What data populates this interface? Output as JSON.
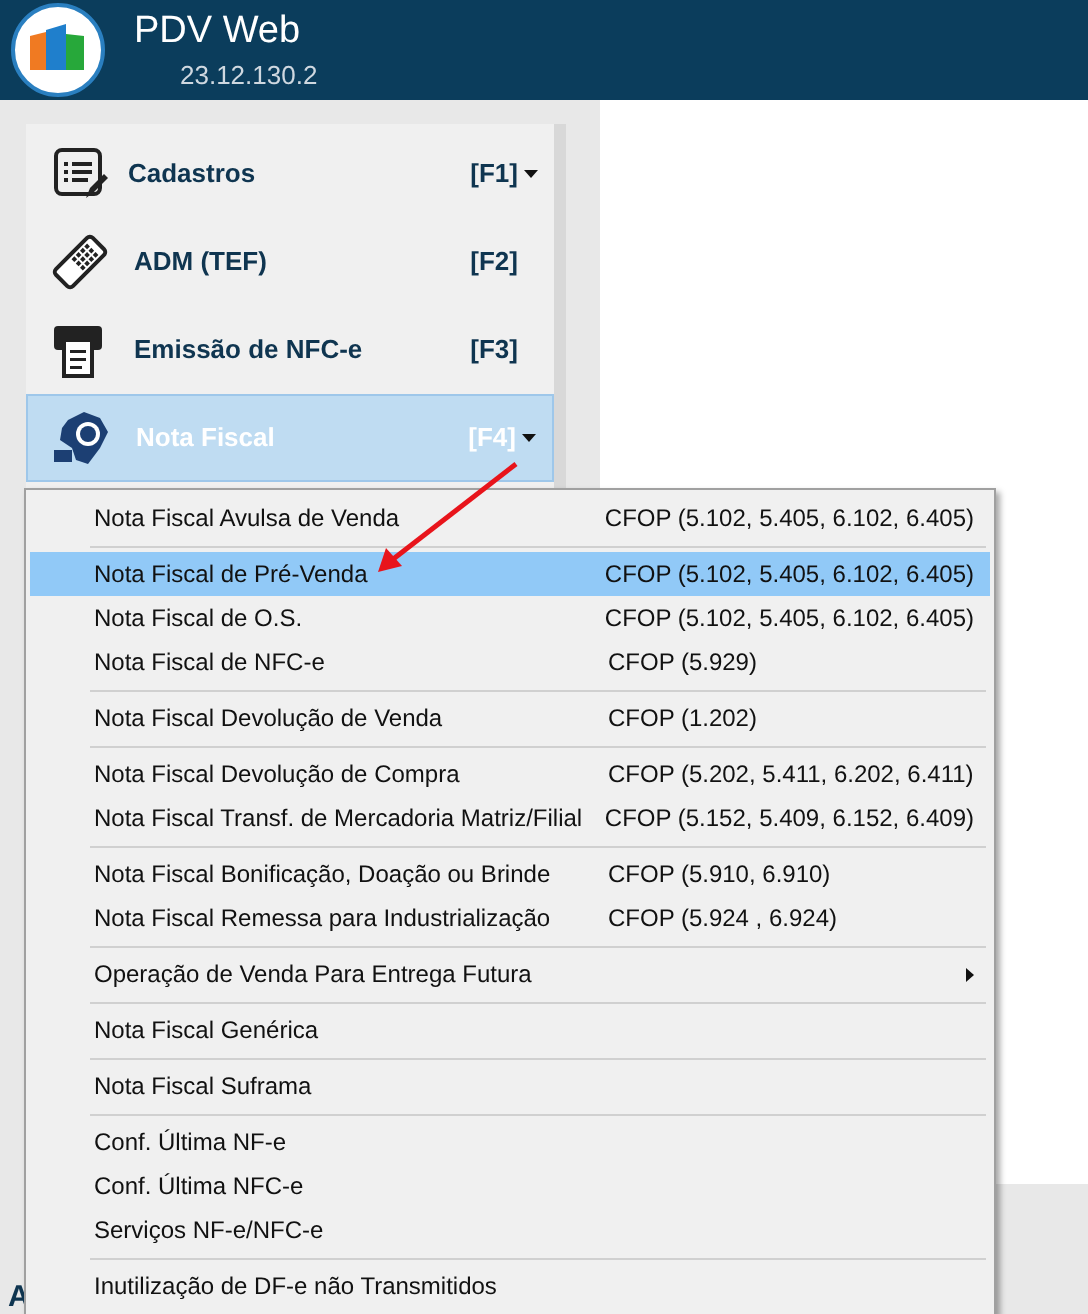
{
  "header": {
    "title": "PDV Web",
    "version": "23.12.130.2"
  },
  "sidebar": {
    "items": [
      {
        "kind": "list",
        "label": "Cadastros",
        "shortcut": "[F1]",
        "dropdown": true,
        "selected": false
      },
      {
        "kind": "terminal",
        "label": "ADM (TEF)",
        "shortcut": "[F2]",
        "dropdown": false,
        "selected": false
      },
      {
        "kind": "printer",
        "label": "Emissão de NFC-e",
        "shortcut": "[F3]",
        "dropdown": false,
        "selected": false
      },
      {
        "kind": "nfe",
        "label": "Nota Fiscal",
        "shortcut": "[F4]",
        "dropdown": true,
        "selected": true
      }
    ]
  },
  "partial_label": "A",
  "menu": {
    "groups": [
      {
        "items": [
          {
            "label": "Nota Fiscal Avulsa de Venda",
            "cfop": "CFOP (5.102, 5.405, 6.102, 6.405)",
            "submenu": false,
            "selected": false
          }
        ]
      },
      {
        "items": [
          {
            "label": "Nota Fiscal de Pré-Venda",
            "cfop": "CFOP (5.102, 5.405, 6.102, 6.405)",
            "submenu": false,
            "selected": true
          },
          {
            "label": "Nota Fiscal de O.S.",
            "cfop": "CFOP (5.102, 5.405, 6.102, 6.405)",
            "submenu": false,
            "selected": false
          },
          {
            "label": "Nota Fiscal de NFC-e",
            "cfop": "CFOP (5.929)",
            "submenu": false,
            "selected": false
          }
        ]
      },
      {
        "items": [
          {
            "label": "Nota Fiscal Devolução de Venda",
            "cfop": "CFOP (1.202)",
            "submenu": false,
            "selected": false
          }
        ]
      },
      {
        "items": [
          {
            "label": "Nota Fiscal Devolução de Compra",
            "cfop": "CFOP (5.202, 5.411, 6.202, 6.411)",
            "submenu": false,
            "selected": false
          },
          {
            "label": "Nota Fiscal Transf. de Mercadoria Matriz/Filial",
            "cfop": "CFOP (5.152, 5.409, 6.152, 6.409)",
            "submenu": false,
            "selected": false
          }
        ]
      },
      {
        "items": [
          {
            "label": "Nota Fiscal Bonificação, Doação ou Brinde",
            "cfop": "CFOP (5.910, 6.910)",
            "submenu": false,
            "selected": false
          },
          {
            "label": "Nota Fiscal Remessa para Industrialização",
            "cfop": "CFOP (5.924 , 6.924)",
            "submenu": false,
            "selected": false
          }
        ]
      },
      {
        "items": [
          {
            "label": "Operação de Venda Para Entrega Futura",
            "submenu": true,
            "selected": false
          }
        ]
      },
      {
        "items": [
          {
            "label": "Nota Fiscal Genérica",
            "submenu": false,
            "selected": false
          }
        ]
      },
      {
        "items": [
          {
            "label": "Nota Fiscal Suframa",
            "submenu": false,
            "selected": false
          }
        ]
      },
      {
        "items": [
          {
            "label": "Conf. Última NF-e",
            "submenu": false,
            "selected": false
          },
          {
            "label": "Conf. Última NFC-e",
            "submenu": false,
            "selected": false
          },
          {
            "label": "Serviços NF-e/NFC-e",
            "submenu": false,
            "selected": false
          }
        ]
      },
      {
        "items": [
          {
            "label": "Inutilização de DF-e não Transmitidos",
            "submenu": false,
            "selected": false
          }
        ]
      }
    ]
  }
}
